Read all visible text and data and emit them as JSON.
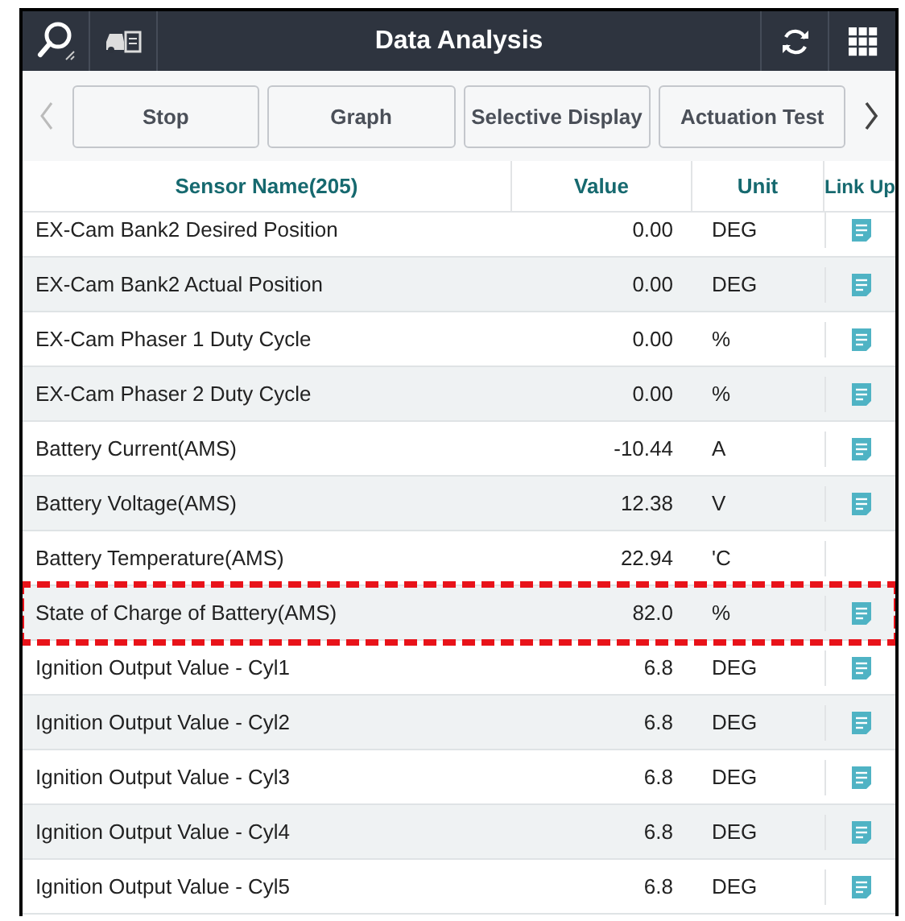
{
  "window": {
    "title": "Data Analysis"
  },
  "toolbar": {
    "buttons": [
      "Stop",
      "Graph",
      "Selective Display",
      "Actuation Test"
    ]
  },
  "table": {
    "columns": [
      "Sensor Name(205)",
      "Value",
      "Unit",
      "Link Up"
    ],
    "rows": [
      {
        "name": "EX-Cam Bank2 Desired Position",
        "value": "0.00",
        "unit": "DEG",
        "link": true,
        "highlighted": false
      },
      {
        "name": "EX-Cam Bank2 Actual Position",
        "value": "0.00",
        "unit": "DEG",
        "link": true,
        "highlighted": false
      },
      {
        "name": "EX-Cam Phaser 1 Duty Cycle",
        "value": "0.00",
        "unit": "%",
        "link": true,
        "highlighted": false
      },
      {
        "name": "EX-Cam Phaser 2 Duty Cycle",
        "value": "0.00",
        "unit": "%",
        "link": true,
        "highlighted": false
      },
      {
        "name": "Battery Current(AMS)",
        "value": "-10.44",
        "unit": "A",
        "link": true,
        "highlighted": false
      },
      {
        "name": "Battery Voltage(AMS)",
        "value": "12.38",
        "unit": "V",
        "link": true,
        "highlighted": false
      },
      {
        "name": "Battery Temperature(AMS)",
        "value": "22.94",
        "unit": "'C",
        "link": false,
        "highlighted": false
      },
      {
        "name": "State of Charge of Battery(AMS)",
        "value": "82.0",
        "unit": "%",
        "link": true,
        "highlighted": true
      },
      {
        "name": "Ignition Output Value - Cyl1",
        "value": "6.8",
        "unit": "DEG",
        "link": true,
        "highlighted": false
      },
      {
        "name": "Ignition Output Value - Cyl2",
        "value": "6.8",
        "unit": "DEG",
        "link": true,
        "highlighted": false
      },
      {
        "name": "Ignition Output Value - Cyl3",
        "value": "6.8",
        "unit": "DEG",
        "link": true,
        "highlighted": false
      },
      {
        "name": "Ignition Output Value - Cyl4",
        "value": "6.8",
        "unit": "DEG",
        "link": true,
        "highlighted": false
      },
      {
        "name": "Ignition Output Value - Cyl5",
        "value": "6.8",
        "unit": "DEG",
        "link": true,
        "highlighted": false
      }
    ]
  }
}
